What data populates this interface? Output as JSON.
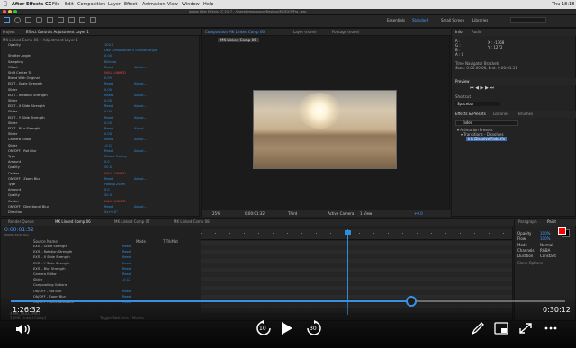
{
  "menubar": {
    "apple": "",
    "app": "After Effects CC",
    "items": [
      "File",
      "Edit",
      "Composition",
      "Layer",
      "Effect",
      "Animation",
      "View",
      "Window",
      "Help"
    ],
    "path": "Adobe After Effects CC 2017 - /Users/tomasmazur/Desktop/MK/EXIT/Pro...aep",
    "clock": "Thu 18:18"
  },
  "workspaces": [
    "Essentials",
    "Standard",
    "Small Screen",
    "Libraries"
  ],
  "effect_controls": {
    "tab": "Effect Controls Adjustment Layer 1",
    "subtitle": "MK Linked Comp 06 • Adjustment Layer 1",
    "rows": [
      {
        "n": "Opacity",
        "v": "100.0"
      },
      {
        "n": "",
        "v": "Use Composition's Shutter Angle"
      },
      {
        "n": "Shutter Angle",
        "v": "0.00"
      },
      {
        "n": "Sampling",
        "v": "Bilinear"
      },
      {
        "n": "Offset",
        "v": "Reset",
        "v2": "About..."
      },
      {
        "n": "Shift Center To",
        "v": "NULL LINKED"
      },
      {
        "n": "Blend With Original",
        "v": "0.0%"
      },
      {
        "n": "EDIT - Scale Strength",
        "v": "Reset",
        "v2": "About..."
      },
      {
        "n": "Slider",
        "v": "0.00"
      },
      {
        "n": "EDIT - Rotation Strength",
        "v": "Reset",
        "v2": "About..."
      },
      {
        "n": "Slider",
        "v": "0.00"
      },
      {
        "n": "EDIT - X Slide Strength",
        "v": "Reset",
        "v2": "About..."
      },
      {
        "n": "Slider",
        "v": "0.00"
      },
      {
        "n": "EDIT - Y Slide Strength",
        "v": "Reset",
        "v2": "About..."
      },
      {
        "n": "Slider",
        "v": "0.00"
      },
      {
        "n": "EDIT - Blur Strength",
        "v": "Reset",
        "v2": "About..."
      },
      {
        "n": "Slider",
        "v": "0.00"
      },
      {
        "n": "Camera Editor",
        "v": "Reset",
        "v2": "About..."
      },
      {
        "n": "Slider",
        "v": "-0.12"
      },
      {
        "n": "ON/OFF - Rot Blur",
        "v": "Reset",
        "v2": "About..."
      },
      {
        "n": "Type",
        "v": "Rotate Fading"
      },
      {
        "n": "Amount",
        "v": "0.0"
      },
      {
        "n": "Quality",
        "v": "50.0"
      },
      {
        "n": "Center",
        "v": "NULL LINKED"
      },
      {
        "n": "ON/OFF - Zoom Blur",
        "v": "Reset",
        "v2": "About..."
      },
      {
        "n": "Type",
        "v": "Fading Zoom"
      },
      {
        "n": "Amount",
        "v": "0.0"
      },
      {
        "n": "Quality",
        "v": "50.0"
      },
      {
        "n": "Center",
        "v": "NULL LINKED"
      },
      {
        "n": "ON/OFF - Directional Blur",
        "v": "Reset",
        "v2": "About..."
      },
      {
        "n": "Direction",
        "v": "0x+0.0°"
      }
    ]
  },
  "comp_viewer": {
    "tabs": [
      "Composition MK Linked Comp 06",
      "Layer (none)",
      "Footage (none)"
    ],
    "breadcrumb": "MK Linked Comp 06",
    "zoom": "25%",
    "timecode": "0:00:01:32",
    "res": "Third",
    "camera": "Active Camera",
    "view": "1 View",
    "exposure": "+0.0"
  },
  "info": {
    "tabs": [
      "Info",
      "Audio"
    ],
    "lines": [
      "R :",
      "G :",
      "B :",
      "A : 0"
    ],
    "coords": [
      "X : -1368",
      "Y : 1272"
    ],
    "desc": [
      "Time Navigator Brackets",
      "Start: 0:00:00:00, End: 0:00:01:11"
    ]
  },
  "preview": {
    "title": "Preview",
    "shortcut": "Shortcut",
    "spacebar": "Spacebar"
  },
  "effects_presets": {
    "tabs": [
      "Effects & Presets",
      "Libraries",
      "Brushes"
    ],
    "search": "fader",
    "tree": [
      "▾ Animation Presets",
      "▾ Transitions - Dissolves",
      "Iris Dissolve Fade.ffx"
    ]
  },
  "timeline": {
    "tabs": [
      "Render Queue",
      "MK Linked Comp 06",
      "MK Linked Comp 07",
      "MK Linked Comp 08"
    ],
    "timecode": "0:00:01:32",
    "fps": "00042 (30.00 fps)",
    "col_headers": [
      "Source Name",
      "Mode",
      "T TrkMat"
    ],
    "layers": [
      "EXIT - Scale Strength",
      "EXIT - Rotation Strength",
      "EXIT - X Slide Strength",
      "EXIT - Y Slide Strength",
      "EXIT - Blur Strength",
      "Camera Editor",
      "Slider",
      "Compositing Options",
      "ON/OFF - Rot Blur",
      "ON/OFF - Zoom Blur",
      "ON/OFF - Directional Blur"
    ],
    "values": [
      "Reset",
      "Reset",
      "Reset",
      "Reset",
      "Reset",
      "Reset",
      "-0.12",
      "",
      "Reset",
      "Reset",
      "Reset"
    ],
    "footer": "Toggle Switches / Modes",
    "bottom_layers": [
      "4  MK_NULL [MK]",
      "5  [MK Linked Comp]"
    ]
  },
  "paragraph": {
    "tabs": [
      "Paragraph",
      "Paint"
    ],
    "labels": [
      "Opacity",
      "Flow",
      "Mode",
      "Channels",
      "Duration",
      "Clone Options"
    ],
    "vals": [
      "100%",
      "100%",
      "Normal",
      "RGBA",
      "Constant",
      ""
    ]
  },
  "player": {
    "elapsed": "1:26:32",
    "remaining": "0:30:12",
    "progress": 0.723,
    "skip_back": "10",
    "skip_fwd": "30"
  },
  "colors": {
    "accent": "#2f8ddb",
    "progress": "#3b8fe0",
    "fg_swatch": "#ff0000",
    "bg_swatch": "#000000"
  }
}
